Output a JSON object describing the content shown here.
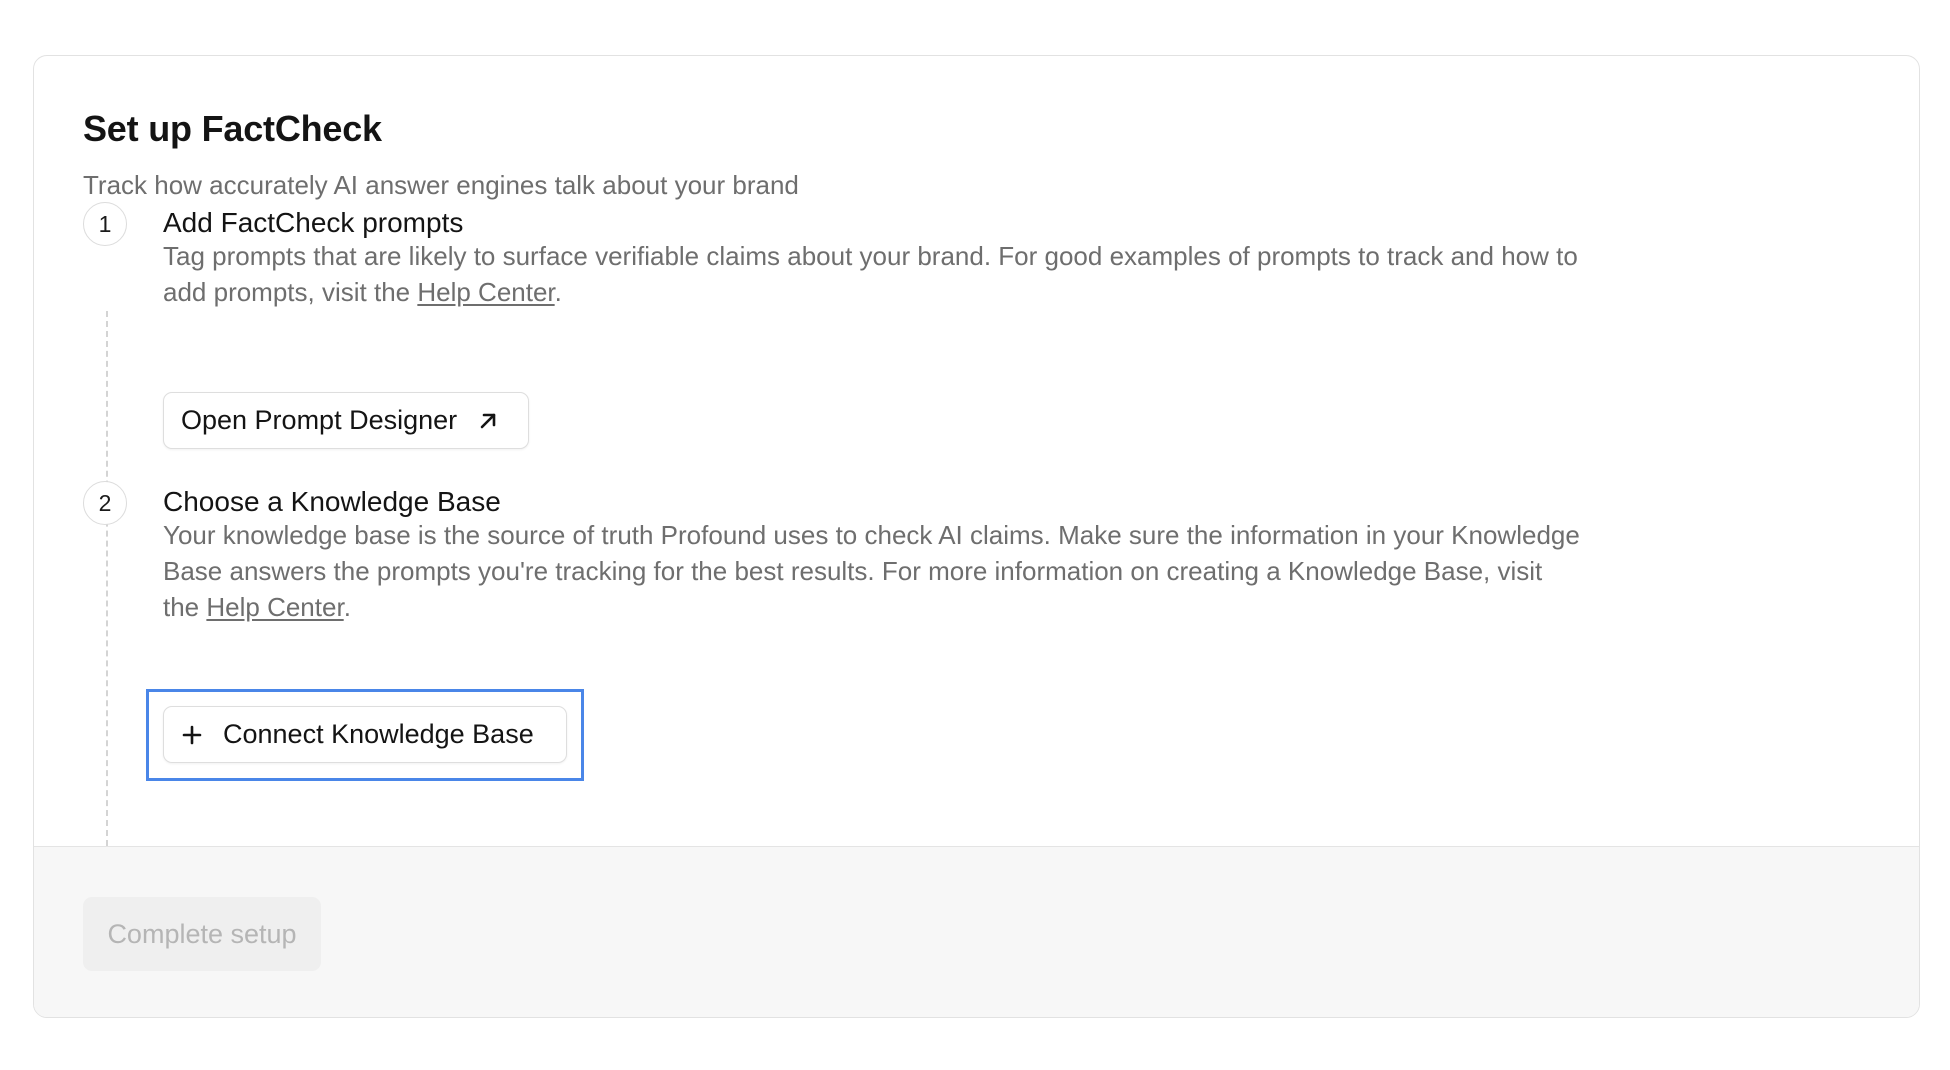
{
  "header": {
    "title": "Set up FactCheck",
    "subtitle": "Track how accurately AI answer engines talk about your brand"
  },
  "steps": [
    {
      "number": "1",
      "title": "Add FactCheck prompts",
      "description_before_link": "Tag prompts that are likely to surface verifiable claims about your brand. For good examples of prompts to track and how to add prompts, visit the ",
      "link_text": "Help Center",
      "description_after_link": ".",
      "button_label": "Open Prompt Designer",
      "button_icon": "arrow-up-right-icon"
    },
    {
      "number": "2",
      "title": "Choose a Knowledge Base",
      "description_before_link": "Your knowledge base is the source of truth Profound uses to check AI claims. Make sure the information in your Knowledge Base answers the prompts you're tracking for the best results. For more information on creating a Knowledge Base, visit the ",
      "link_text": "Help Center",
      "description_after_link": ".",
      "button_label": "Connect Knowledge Base",
      "button_icon": "plus-icon"
    }
  ],
  "footer": {
    "complete_label": "Complete setup"
  },
  "colors": {
    "highlight": "#4a86e8",
    "muted_text": "#6e6e6e",
    "disabled_text": "#b5b5b5"
  }
}
